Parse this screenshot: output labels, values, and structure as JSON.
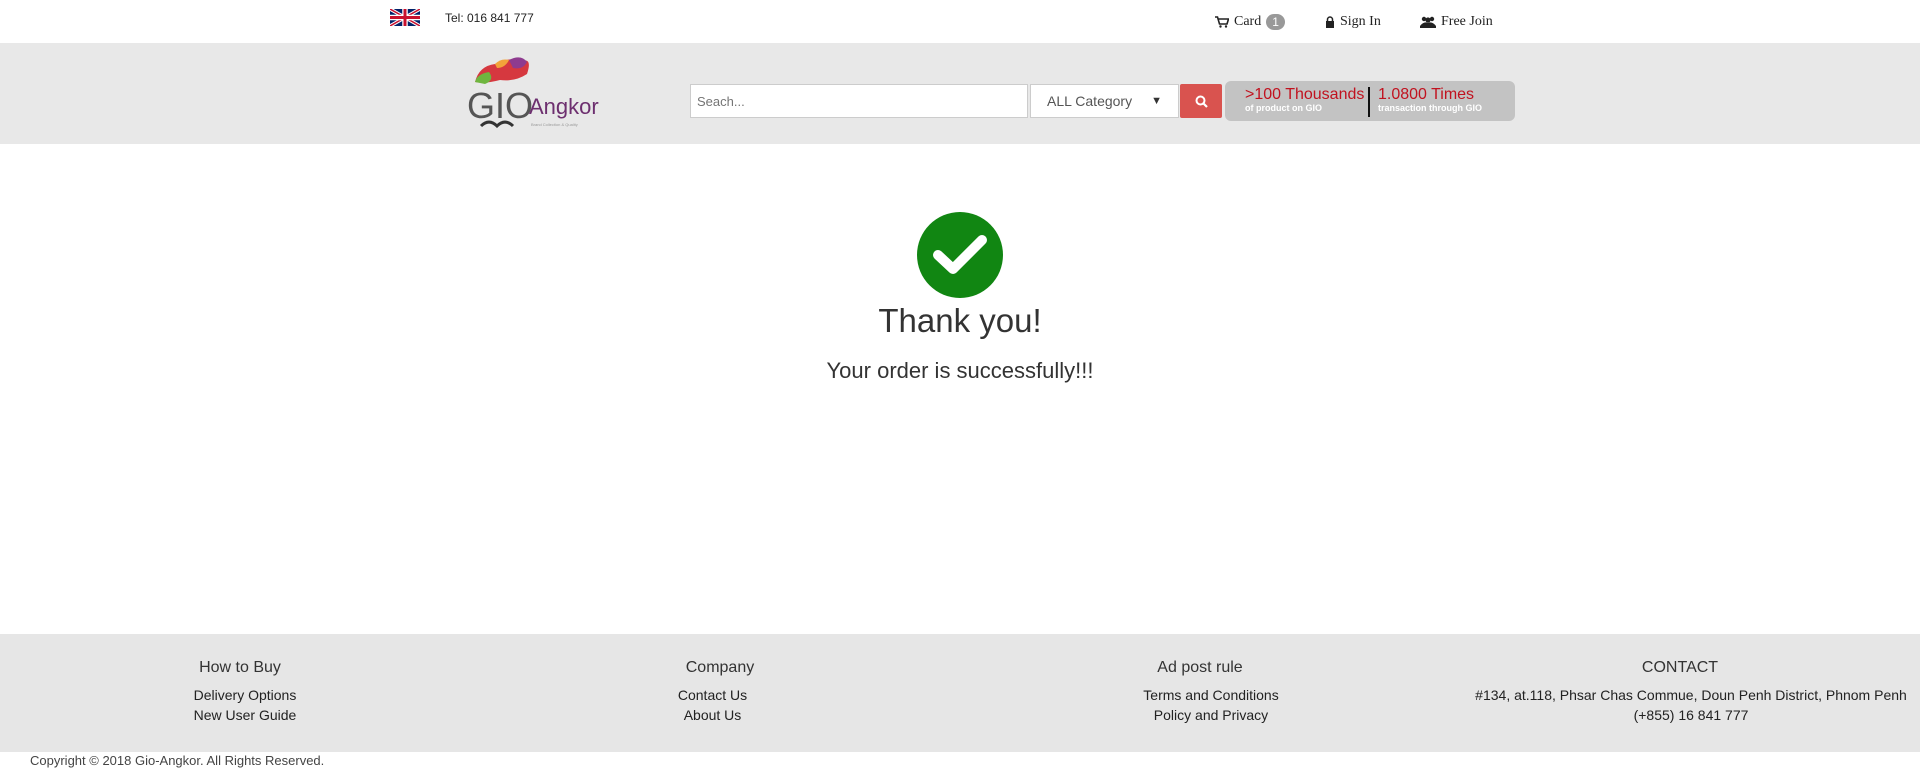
{
  "topbar": {
    "language_icon": "uk-flag-icon",
    "tel": "Tel: 016 841 777",
    "cart_label": "Card",
    "cart_count": "1",
    "signin_label": "Sign In",
    "join_label": "Free Join"
  },
  "header": {
    "search_placeholder": "Seach...",
    "category_selected": "ALL Category",
    "stats": [
      {
        "big": ">100 Thousands",
        "small": "of product on GIO"
      },
      {
        "big": "1.0800 Times",
        "small": "transaction through GIO"
      }
    ],
    "colors": {
      "search_button": "#d9534f",
      "stats_accent": "#c1121f"
    }
  },
  "main": {
    "title": "Thank you!",
    "message": "Your order is successfully!!!",
    "success_color": "#118612"
  },
  "footer": {
    "columns": [
      {
        "heading": "How to Buy",
        "links": [
          "Delivery Options",
          "New User Guide"
        ]
      },
      {
        "heading": "Company",
        "links": [
          "Contact Us",
          "About Us"
        ]
      },
      {
        "heading": "Ad post rule",
        "links": [
          "Terms and Conditions",
          "Policy and Privacy"
        ]
      },
      {
        "heading": "CONTACT",
        "links": [
          "#134, at.118, Phsar Chas Commue, Doun Penh District, Phnom Penh",
          "(+855) 16 841 777"
        ]
      }
    ],
    "copyright": "Copyright © 2018 Gio-Angkor. All Rights Reserved."
  }
}
